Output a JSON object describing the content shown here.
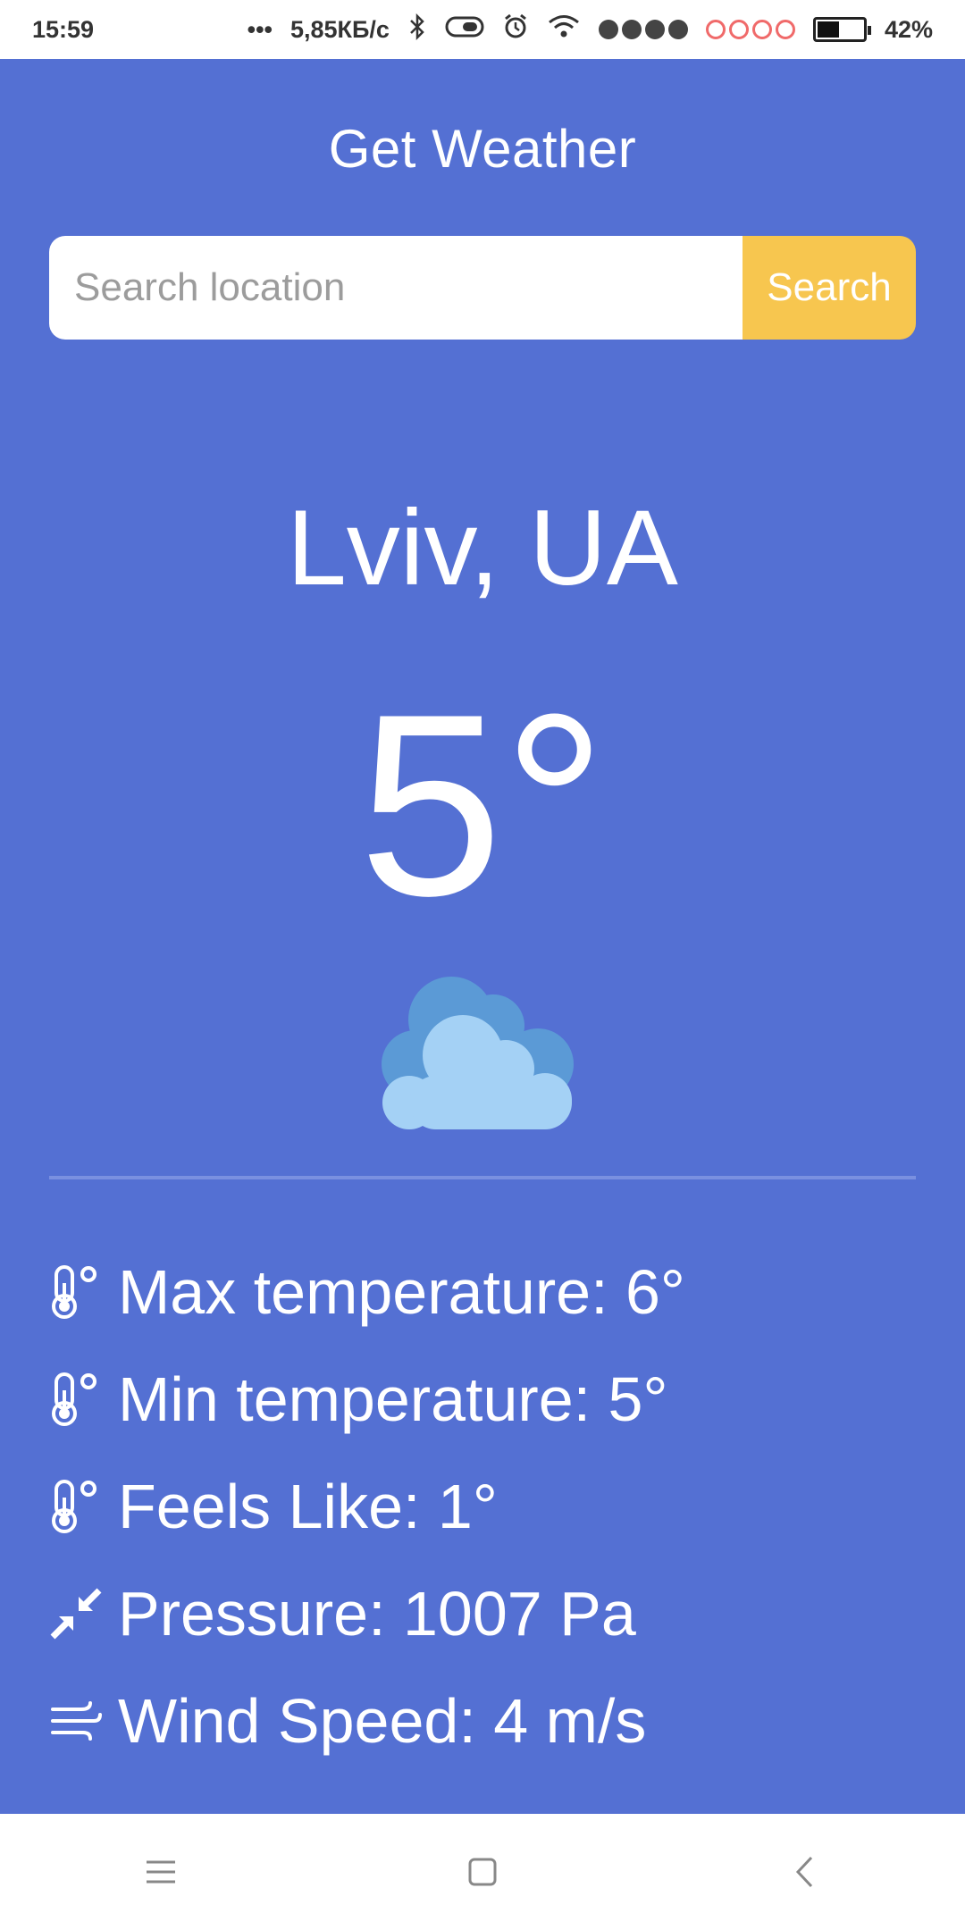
{
  "status_bar": {
    "time": "15:59",
    "more": "•••",
    "network_speed": "5,85КБ/с",
    "battery_percent": "42%",
    "battery_level": 0.42
  },
  "app": {
    "title": "Get Weather",
    "background_color": "#5470d3",
    "accent_color": "#f7c64f"
  },
  "search": {
    "placeholder": "Search location",
    "value": "",
    "button_label": "Search"
  },
  "weather": {
    "location": "Lviv, UA",
    "temperature": "5°",
    "condition_icon": "cloud-icon"
  },
  "stats": [
    {
      "icon": "thermometer-icon",
      "label": "Max temperature: 6°"
    },
    {
      "icon": "thermometer-icon",
      "label": "Min temperature: 5°"
    },
    {
      "icon": "thermometer-icon",
      "label": "Feels Like: 1°"
    },
    {
      "icon": "pressure-arrows-icon",
      "label": "Pressure: 1007 Pa"
    },
    {
      "icon": "wind-icon",
      "label": "Wind Speed: 4 m/s"
    }
  ],
  "nav_bar": {
    "icons": [
      "menu-icon",
      "home-square-icon",
      "back-chevron-icon"
    ]
  }
}
